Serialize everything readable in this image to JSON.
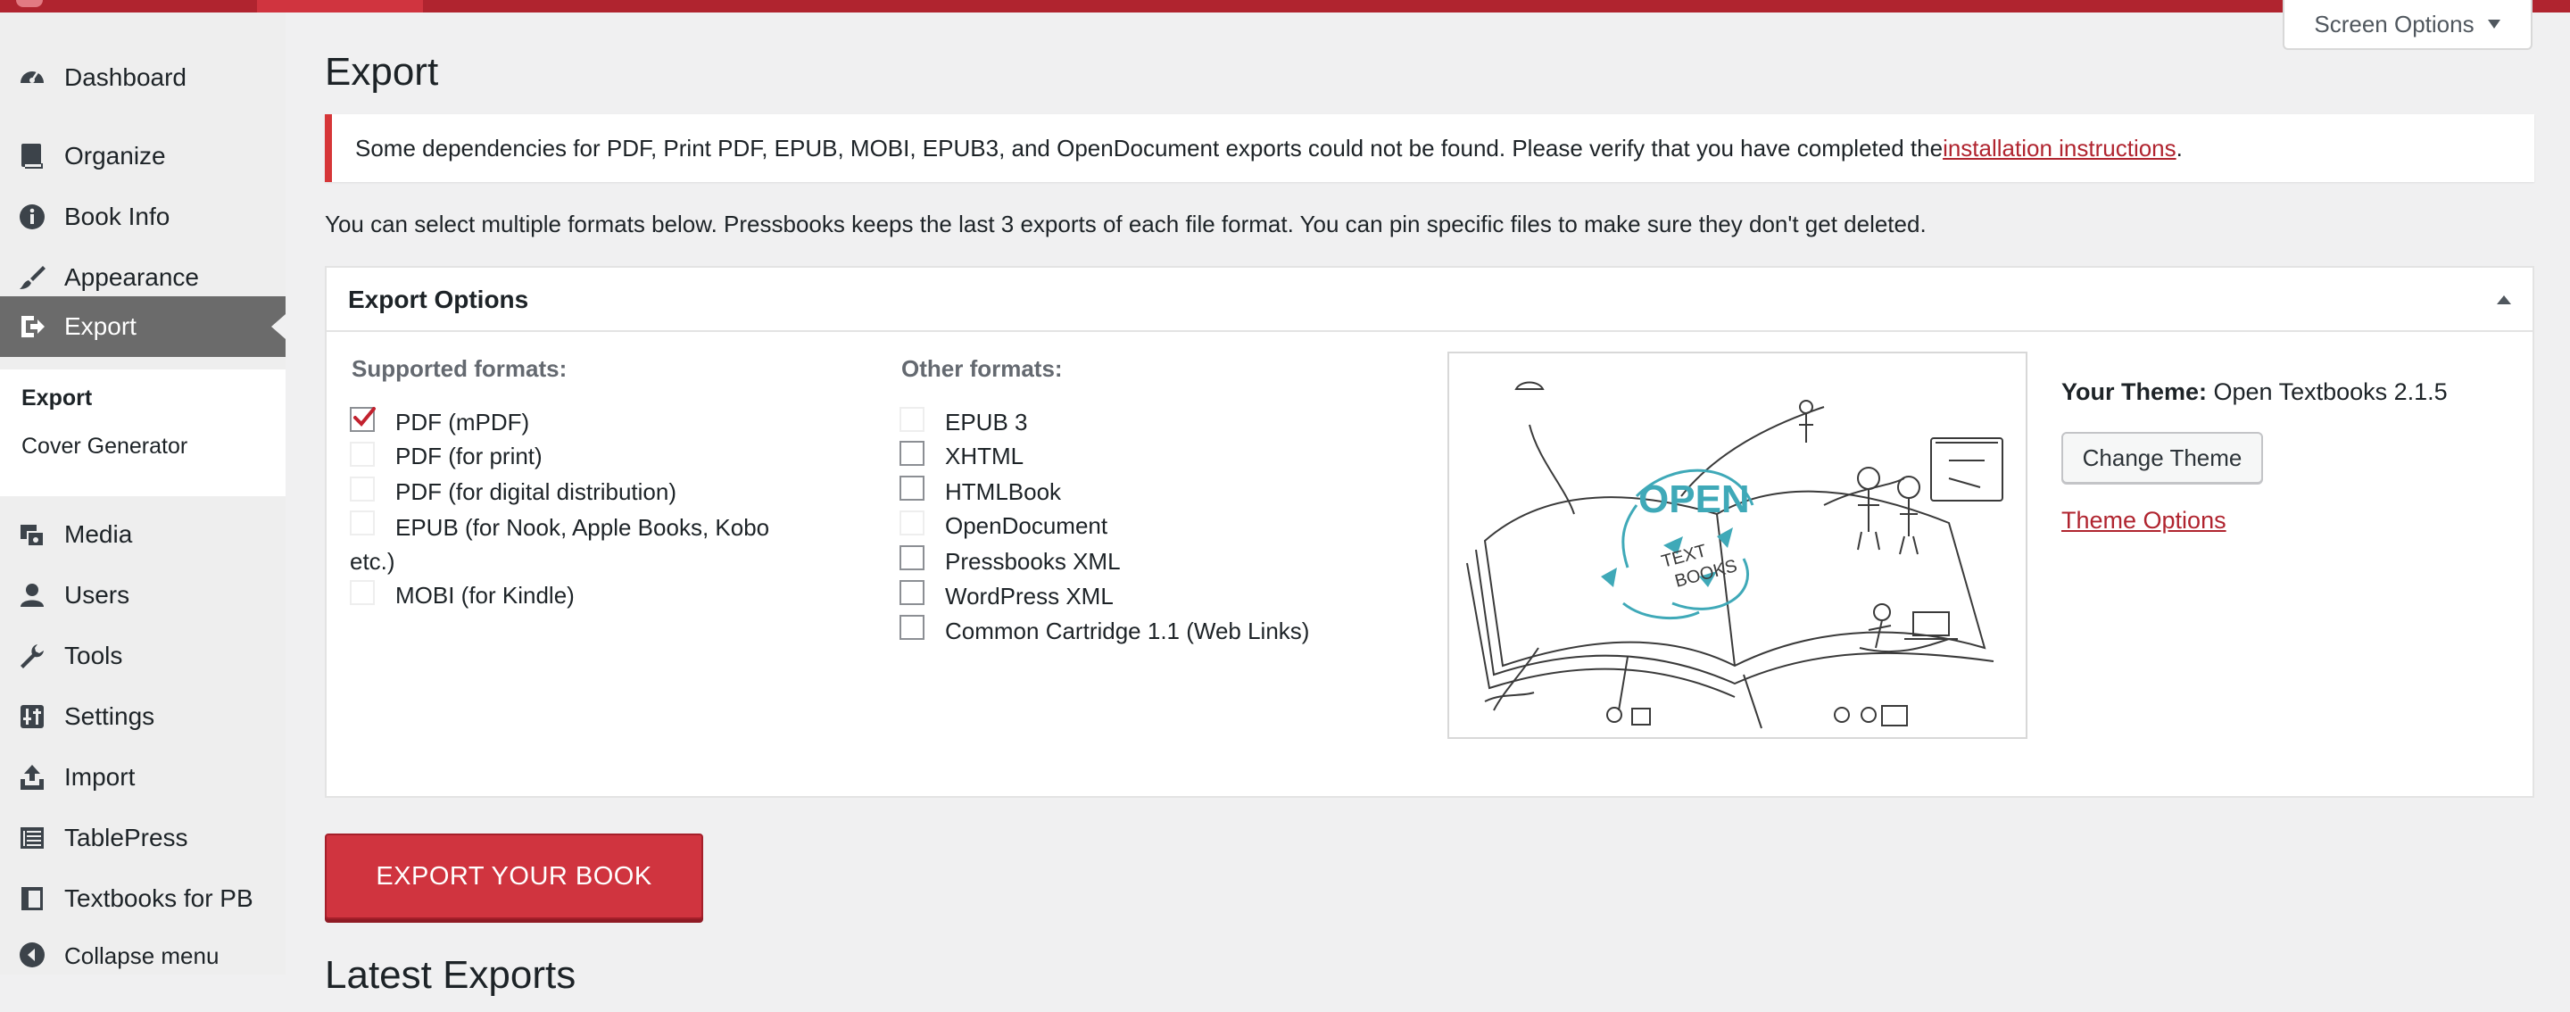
{
  "sidebar": {
    "items": [
      {
        "label": "Dashboard",
        "icon": "dashboard-icon"
      },
      {
        "label": "Organize",
        "icon": "book-icon"
      },
      {
        "label": "Book Info",
        "icon": "info-icon"
      },
      {
        "label": "Appearance",
        "icon": "brush-icon"
      },
      {
        "label": "Export",
        "icon": "export-icon"
      },
      {
        "label": "Media",
        "icon": "media-icon"
      },
      {
        "label": "Users",
        "icon": "users-icon"
      },
      {
        "label": "Tools",
        "icon": "wrench-icon"
      },
      {
        "label": "Settings",
        "icon": "settings-icon"
      },
      {
        "label": "Import",
        "icon": "import-icon"
      },
      {
        "label": "TablePress",
        "icon": "table-icon"
      },
      {
        "label": "Textbooks for PB",
        "icon": "textbook-icon"
      },
      {
        "label": "Collapse menu",
        "icon": "collapse-icon"
      }
    ],
    "submenu": [
      {
        "label": "Export"
      },
      {
        "label": "Cover Generator"
      }
    ]
  },
  "header": {
    "screen_options": "Screen Options",
    "title": "Export"
  },
  "notice": {
    "text": "Some dependencies for PDF, Print PDF, EPUB, MOBI, EPUB3, and OpenDocument exports could not be found. Please verify that you have completed the ",
    "link": "installation instructions",
    "end": "."
  },
  "intro": "You can select multiple formats below. Pressbooks keeps the last 3 exports of each file format. You can pin specific files to make sure they don't get deleted.",
  "panel": {
    "title": "Export Options",
    "supported_heading": "Supported formats:",
    "supported": [
      {
        "label": "PDF (mPDF)",
        "checked": true
      },
      {
        "label": "PDF (for print)",
        "checked": false
      },
      {
        "label": "PDF (for digital distribution)",
        "checked": false
      },
      {
        "label": "EPUB (for Nook, Apple Books, Kobo",
        "label2": "etc.)",
        "checked": false
      },
      {
        "label": "MOBI (for Kindle)",
        "checked": false
      }
    ],
    "other_heading": "Other formats:",
    "other": [
      {
        "label": "EPUB 3",
        "checked": false
      },
      {
        "label": "XHTML",
        "checked": false
      },
      {
        "label": "HTMLBook",
        "checked": false
      },
      {
        "label": "OpenDocument",
        "checked": false
      },
      {
        "label": "Pressbooks XML",
        "checked": false
      },
      {
        "label": "WordPress XML",
        "checked": false
      },
      {
        "label": "Common Cartridge 1.1 (Web Links)",
        "checked": false
      }
    ],
    "illustration_text": {
      "open": "OPEN",
      "text": "TEXT",
      "books": "BOOKS"
    },
    "theme_label": "Your Theme:",
    "theme_name": " Open Textbooks 2.1.5",
    "change_theme": "Change Theme",
    "theme_options": "Theme Options"
  },
  "export_button": "EXPORT YOUR BOOK",
  "latest_heading": "Latest Exports",
  "colors": {
    "brand": "#b0242f",
    "button": "#d0343f",
    "sidebar_current": "#6b6b6b",
    "notice_border": "#d63638"
  }
}
